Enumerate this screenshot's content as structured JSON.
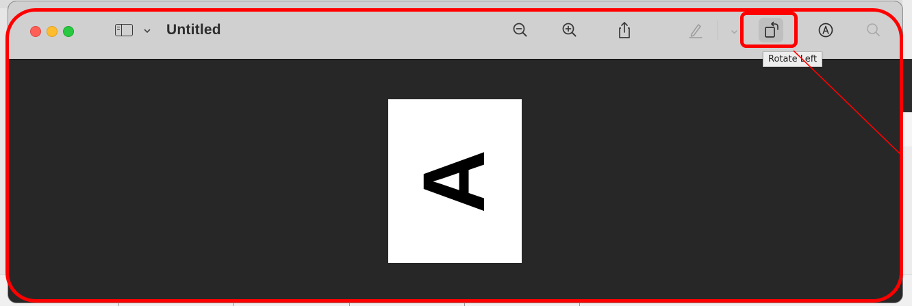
{
  "window": {
    "title": "Untitled"
  },
  "toolbar": {
    "sidebar_toggle_icon": "sidebar-toggle-icon",
    "zoom_out_icon": "zoom-out-icon",
    "zoom_in_icon": "zoom-in-icon",
    "share_icon": "share-icon",
    "highlight_icon": "highlight-pen-icon",
    "rotate_icon": "rotate-left-icon",
    "markup_icon": "markup-icon",
    "search_icon": "search-icon"
  },
  "tooltip": {
    "text": "Rotate Left"
  },
  "document": {
    "page_letter": "A"
  },
  "colors": {
    "annotation": "#ff0000",
    "titlebar": "#d0d0d0",
    "content_bg": "#272727",
    "close": "#ff5f57",
    "minimize": "#febc2e",
    "maximize": "#28c840"
  }
}
